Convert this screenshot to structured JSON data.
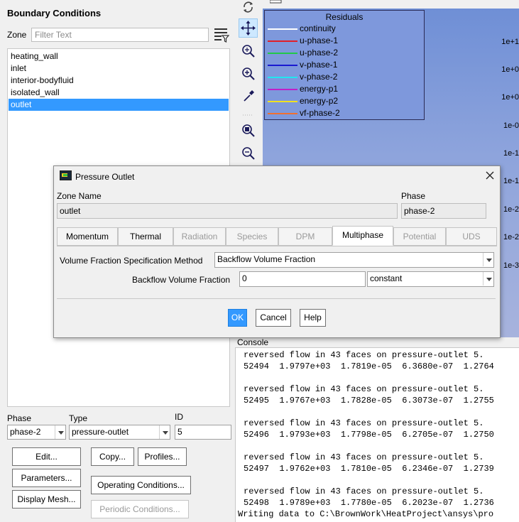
{
  "left_panel": {
    "title": "Boundary Conditions",
    "zone_label": "Zone",
    "filter_placeholder": "Filter Text",
    "zones": [
      "heating_wall",
      "inlet",
      "interior-bodyfluid",
      "isolated_wall",
      "outlet"
    ],
    "selected_zone": "outlet",
    "phase_label": "Phase",
    "phase_value": "phase-2",
    "type_label": "Type",
    "type_value": "pressure-outlet",
    "id_label": "ID",
    "id_value": "5",
    "buttons": {
      "edit": "Edit...",
      "copy": "Copy...",
      "profiles": "Profiles...",
      "parameters": "Parameters...",
      "operating_conditions": "Operating Conditions...",
      "display_mesh": "Display Mesh...",
      "periodic_conditions": "Periodic Conditions..."
    }
  },
  "residuals": {
    "legend_title": "Residuals",
    "series": [
      {
        "name": "continuity",
        "color": "#ffffff"
      },
      {
        "name": "u-phase-1",
        "color": "#e0202a"
      },
      {
        "name": "u-phase-2",
        "color": "#22c84a"
      },
      {
        "name": "v-phase-1",
        "color": "#1a1ad0"
      },
      {
        "name": "v-phase-2",
        "color": "#22e6f0"
      },
      {
        "name": "energy-p1",
        "color": "#c020c8"
      },
      {
        "name": "energy-p2",
        "color": "#f0e020"
      },
      {
        "name": "vf-phase-2",
        "color": "#f07030"
      }
    ],
    "y_ticks": [
      "1e+1",
      "1e+0",
      "1e+0",
      "1e-0",
      "1e-1",
      "1e-1",
      "1e-2",
      "1e-2",
      "1e-3"
    ]
  },
  "console": {
    "label": "Console",
    "lines": [
      "reversed flow in 43 faces on pressure-outlet 5.",
      "52494  1.9797e+03  1.7819e-05  6.3680e-07  1.2764",
      "",
      "reversed flow in 43 faces on pressure-outlet 5.",
      "52495  1.9767e+03  1.7828e-05  6.3073e-07  1.2755",
      "",
      "reversed flow in 43 faces on pressure-outlet 5.",
      "52496  1.9793e+03  1.7798e-05  6.2705e-07  1.2750",
      "",
      "reversed flow in 43 faces on pressure-outlet 5.",
      "52497  1.9762e+03  1.7810e-05  6.2346e-07  1.2739",
      "",
      "reversed flow in 43 faces on pressure-outlet 5.",
      "52498  1.9789e+03  1.7780e-05  6.2023e-07  1.2736",
      "Writing data to C:\\BrownWork\\HeatProject\\ansys\\pro"
    ]
  },
  "dialog": {
    "title": "Pressure Outlet",
    "zone_name_label": "Zone Name",
    "zone_name_value": "outlet",
    "phase_label": "Phase",
    "phase_value": "phase-2",
    "tabs": [
      {
        "label": "Momentum",
        "state": "enabled"
      },
      {
        "label": "Thermal",
        "state": "enabled"
      },
      {
        "label": "Radiation",
        "state": "disabled"
      },
      {
        "label": "Species",
        "state": "disabled"
      },
      {
        "label": "DPM",
        "state": "disabled"
      },
      {
        "label": "Multiphase",
        "state": "active"
      },
      {
        "label": "Potential",
        "state": "disabled"
      },
      {
        "label": "UDS",
        "state": "disabled"
      }
    ],
    "vf_method_label": "Volume Fraction Specification Method",
    "vf_method_value": "Backflow Volume Fraction",
    "backflow_label": "Backflow Volume Fraction",
    "backflow_value": "0",
    "backflow_profile": "constant",
    "ok": "OK",
    "cancel": "Cancel",
    "help": "Help"
  },
  "colors": {
    "selection": "#3399ff",
    "graphics_bg": "#8ea4dc"
  }
}
